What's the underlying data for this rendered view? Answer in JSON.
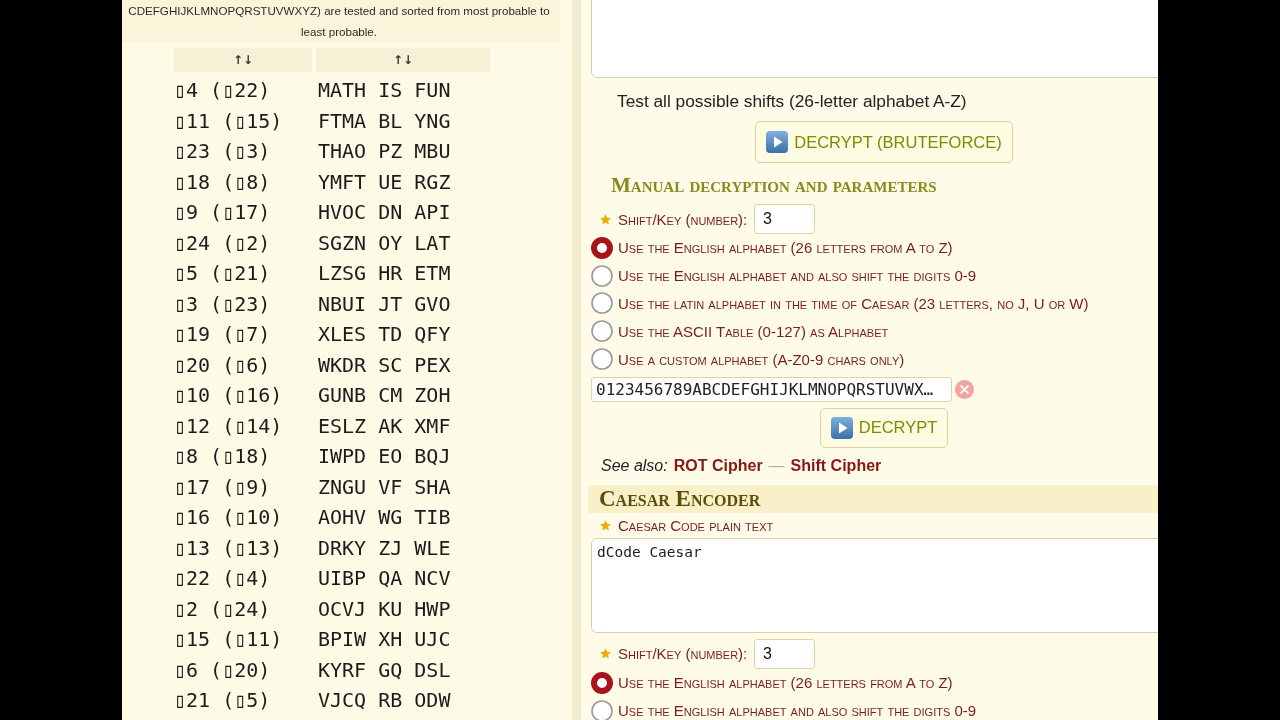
{
  "decoder_results": {
    "intro": "CDEFGHIJKLMNOPQRSTUVWXYZ) are tested and sorted from most probable to least probable.",
    "columns": [
      "↑↓",
      "↑↓"
    ],
    "rows": [
      {
        "shift": "▯4 (▯22)",
        "text": "MATH IS FUN"
      },
      {
        "shift": "▯11 (▯15)",
        "text": "FTMA BL YNG"
      },
      {
        "shift": "▯23 (▯3)",
        "text": "THAO PZ MBU"
      },
      {
        "shift": "▯18 (▯8)",
        "text": "YMFT UE RGZ"
      },
      {
        "shift": "▯9 (▯17)",
        "text": "HVOC DN API"
      },
      {
        "shift": "▯24 (▯2)",
        "text": "SGZN OY LAT"
      },
      {
        "shift": "▯5 (▯21)",
        "text": "LZSG HR ETM"
      },
      {
        "shift": "▯3 (▯23)",
        "text": "NBUI JT GVO"
      },
      {
        "shift": "▯19 (▯7)",
        "text": "XLES TD QFY"
      },
      {
        "shift": "▯20 (▯6)",
        "text": "WKDR SC PEX"
      },
      {
        "shift": "▯10 (▯16)",
        "text": "GUNB CM ZOH"
      },
      {
        "shift": "▯12 (▯14)",
        "text": "ESLZ AK XMF"
      },
      {
        "shift": "▯8 (▯18)",
        "text": "IWPD EO BQJ"
      },
      {
        "shift": "▯17 (▯9)",
        "text": "ZNGU VF SHA"
      },
      {
        "shift": "▯16 (▯10)",
        "text": "AOHV WG TIB"
      },
      {
        "shift": "▯13 (▯13)",
        "text": "DRKY ZJ WLE"
      },
      {
        "shift": "▯22 (▯4)",
        "text": "UIBP QA NCV"
      },
      {
        "shift": "▯2 (▯24)",
        "text": "OCVJ KU HWP"
      },
      {
        "shift": "▯15 (▯11)",
        "text": "BPIW XH UJC"
      },
      {
        "shift": "▯6 (▯20)",
        "text": "KYRF GQ DSL"
      },
      {
        "shift": "▯21 (▯5)",
        "text": "VJCQ RB ODW"
      }
    ]
  },
  "decoder": {
    "bruteforce_hint": "Test all possible shifts (26-letter alphabet A-Z)",
    "bruteforce_button": "DECRYPT (BRUTEFORCE)",
    "manual_heading": "Manual decryption and parameters",
    "shift_label": "Shift/Key (number):",
    "shift_value": "3",
    "alphabet_options": [
      {
        "label": "Use the English alphabet (26 letters from A to Z)",
        "selected": true
      },
      {
        "label": "Use the English alphabet and also shift the digits 0-9",
        "selected": false
      },
      {
        "label": "Use the latin alphabet in the time of Caesar (23 letters, no J, U or W)",
        "selected": false
      },
      {
        "label": "Use the ASCII Table (0-127) as Alphabet",
        "selected": false
      },
      {
        "label": "Use a custom alphabet (A-Z0-9 chars only)",
        "selected": false
      }
    ],
    "custom_alphabet": "0123456789ABCDEFGHIJKLMNOPQRSTUVWX…",
    "decrypt_button": "DECRYPT",
    "see_also": {
      "label": "See also:",
      "links": [
        "ROT Cipher",
        "Shift Cipher"
      ],
      "separator": "—"
    }
  },
  "encoder": {
    "title": "Caesar Encoder",
    "plaintext_label": "Caesar Code plain text",
    "plaintext": "dCode Caesar",
    "shift_label": "Shift/Key (number):",
    "shift_value": "3",
    "alphabet_options": [
      {
        "label": "Use the English alphabet (26 letters from A to Z)",
        "selected": true
      },
      {
        "label": "Use the English alphabet and also shift the digits 0-9",
        "selected": false
      }
    ]
  }
}
